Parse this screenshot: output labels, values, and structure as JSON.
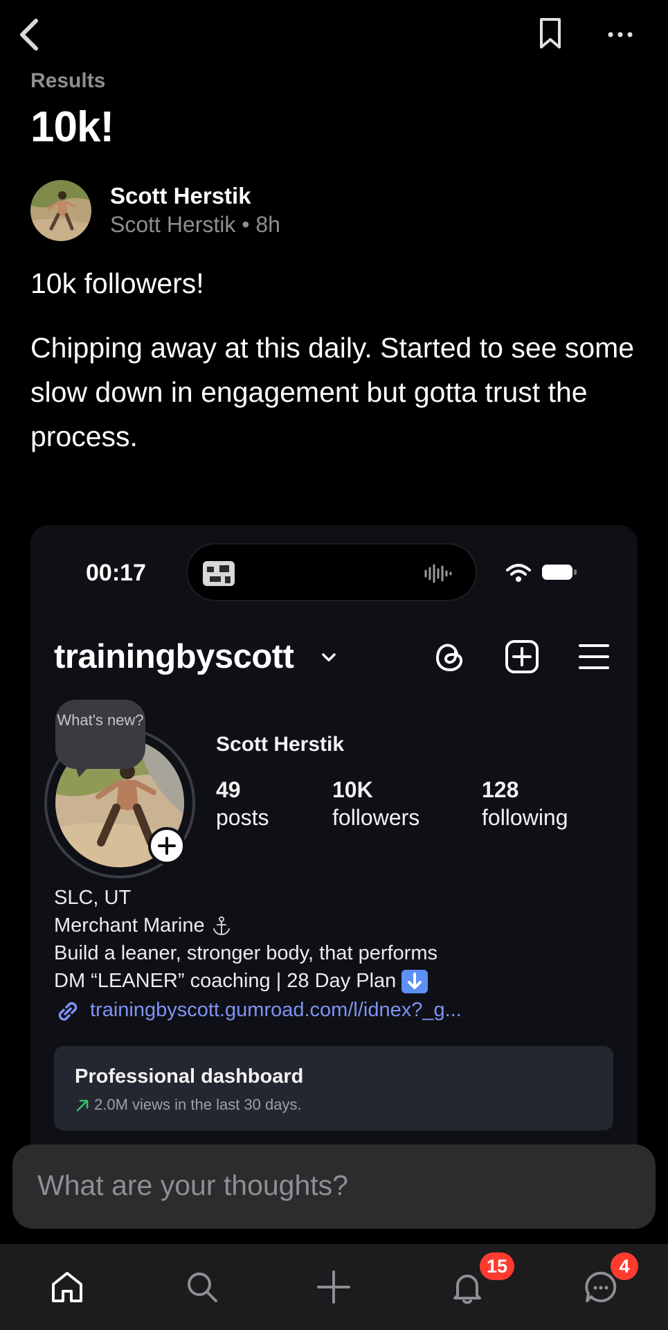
{
  "header": {
    "back_icon": "chevron-left-icon",
    "bookmark_icon": "bookmark-icon",
    "more_icon": "ellipsis-icon"
  },
  "post": {
    "section": "Results",
    "title": "10k!",
    "author": {
      "name": "Scott Herstik",
      "handle": "Scott Herstik",
      "time": "8h",
      "meta": "Scott Herstik • 8h"
    },
    "subtitle": "10k followers!",
    "body": "Chipping away at this daily. Started to see some slow down in engagement but gotta trust the process."
  },
  "embed": {
    "status_time": "00:17",
    "username": "trainingbyscott",
    "bubble_text": "What's new?",
    "full_name": "Scott Herstik",
    "stats": [
      {
        "value": "49",
        "label": "posts"
      },
      {
        "value": "10K",
        "label": "followers"
      },
      {
        "value": "128",
        "label": "following"
      }
    ],
    "bio": {
      "line1": "SLC, UT",
      "line2": "Merchant Marine",
      "line3": "Build a leaner, stronger body, that performs",
      "line4": "DM “LEANER” coaching | 28 Day Plan"
    },
    "link": "trainingbyscott.gumroad.com/l/idnex?_g...",
    "dashboard": {
      "title": "Professional dashboard",
      "subtitle": "2.0M views in the last 30 days."
    }
  },
  "composer": {
    "placeholder": "What are your thoughts?"
  },
  "tabbar": {
    "items": [
      {
        "name": "home",
        "icon": "home-icon"
      },
      {
        "name": "search",
        "icon": "search-icon"
      },
      {
        "name": "create",
        "icon": "plus-icon"
      },
      {
        "name": "notifications",
        "icon": "bell-icon",
        "badge": "15"
      },
      {
        "name": "messages",
        "icon": "chat-icon",
        "badge": "4"
      }
    ]
  },
  "colors": {
    "background": "#000000",
    "secondary_text": "#8e8e93",
    "badge": "#ff3b30",
    "link": "#7f93f4"
  }
}
